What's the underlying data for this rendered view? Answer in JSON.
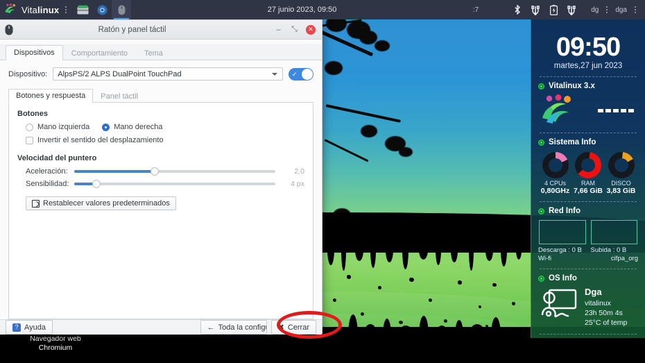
{
  "top_panel": {
    "brand": "Vitalinux",
    "brand_thin": "Vita",
    "brand_bold": "linux",
    "menu_dots_icon": "vertical-dots-icon",
    "files_icon": "file-manager-icon",
    "browser_icon": "chromium-icon",
    "mouse_icon": "mouse-settings-icon",
    "clock": "27 junio 2023, 09:50",
    "window_label": ":7",
    "bluetooth_icon": "bluetooth-icon",
    "usb_icon_1": "usb-icon",
    "battery_icon": "battery-icon",
    "usb_icon_2": "usb-icon",
    "user_label_1": "dg",
    "user_label_2": "dga"
  },
  "dialog": {
    "icon": "mouse-icon",
    "title": "Ratón y panel táctil",
    "minimize_label": "–",
    "maximize_label": "⤡",
    "close_label": "✕",
    "tabs": [
      {
        "label": "Dispositivos",
        "selected": true
      },
      {
        "label": "Comportamiento",
        "selected": false
      },
      {
        "label": "Tema",
        "selected": false
      }
    ],
    "device_label": "Dispositivo:",
    "device_value": "AlpsPS/2 ALPS DualPoint TouchPad",
    "device_toggle_on": true,
    "inner_tabs": [
      {
        "label": "Botones y respuesta",
        "selected": true
      },
      {
        "label": "Panel táctil",
        "selected": false
      }
    ],
    "buttons_group_title": "Botones",
    "radio_left": "Mano izquierda",
    "radio_right": "Mano derecha",
    "radio_selected": "right",
    "checkbox_invert": "Invertir el sentido del desplazamiento",
    "checkbox_invert_checked": false,
    "pointer_group_title": "Velocidad del puntero",
    "accel_label": "Aceleración:",
    "accel_value": "2,0",
    "accel_percent": 40,
    "sens_label": "Sensibilidad:",
    "sens_value": "4 px",
    "sens_percent": 11,
    "reset_button": "Restablecer valores predeterminados",
    "help_button": "Ayuda",
    "help_icon": "question-mark-icon",
    "all_settings_button": "Toda la configuració",
    "all_settings_icon": "arrow-left-icon",
    "close_button": "Cerrar",
    "close_button_icon": "close-x-icon"
  },
  "conky": {
    "clock": "09:50",
    "date": "martes,27 jun 2023",
    "section_vitalinux": "Vitalinux 3.x",
    "logo_icon": "vitalinux-runner-logo",
    "dashes_count": 5,
    "section_sistema": "Sistema Info",
    "gauges": [
      {
        "label": "4 CPUs",
        "value": "0,80GHz",
        "color": "#f07ab4",
        "percent": 18
      },
      {
        "label": "RAM",
        "value": "7,66 GiB",
        "color": "#ee1111",
        "percent": 62
      },
      {
        "label": "DISCO",
        "value": "3,83 GiB",
        "color": "#f0a020",
        "percent": 16
      }
    ],
    "section_red": "Red Info",
    "download_label": "Descarga : 0 B",
    "upload_label": "Subida : 0 B",
    "connection_type": "Wi-fi",
    "network_name": "cifpa_org",
    "section_os": "OS Info",
    "os_icon": "computer-user-icon",
    "os_user": "Dga",
    "os_name": "vitalinux",
    "os_uptime": "23h 50m 4s",
    "os_temp": "25°C of temp"
  },
  "desktop": {
    "icon_label_line1": "Navegador web",
    "icon_label_line2": "Chromium"
  },
  "annotation": {
    "shape": "red-ellipse-highlight",
    "color": "#e01b1b",
    "target": "close-button"
  },
  "colors": {
    "panel_bg": "#2f3545",
    "accent_blue": "#3c8ae0",
    "conky_top": "#0b2a52",
    "conky_bottom": "#13562e",
    "annotation_red": "#e01b1b"
  }
}
